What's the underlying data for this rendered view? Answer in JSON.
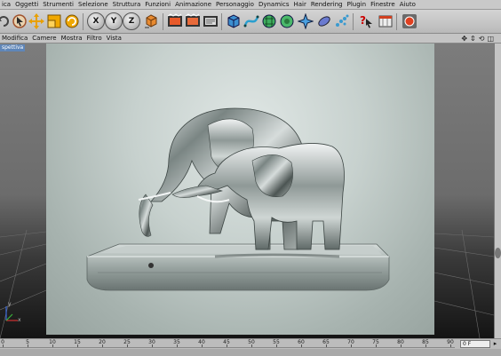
{
  "menubar": {
    "items": [
      "ica",
      "Oggetti",
      "Strumenti",
      "Selezione",
      "Struttura",
      "Funzioni",
      "Animazione",
      "Personaggio",
      "Dynamics",
      "Hair",
      "Rendering",
      "Plugin",
      "Finestre",
      "Aiuto"
    ]
  },
  "toolbar": {
    "axis_x": "X",
    "axis_y": "Y",
    "axis_z": "Z"
  },
  "viewport_menu": {
    "items": [
      "Modifica",
      "Camere",
      "Mostra",
      "Filtro",
      "Vista"
    ],
    "nav_icons": [
      "✥",
      "⇕",
      "⟲",
      "◫"
    ]
  },
  "viewport": {
    "label": "spettiva",
    "axis_x": "x",
    "axis_y": "y"
  },
  "timeline": {
    "ticks": [
      "0",
      "5",
      "10",
      "15",
      "20",
      "25",
      "30",
      "35",
      "40",
      "45",
      "50",
      "55",
      "60",
      "65",
      "70",
      "75",
      "80",
      "85",
      "90"
    ],
    "current_frame": "0 F"
  }
}
